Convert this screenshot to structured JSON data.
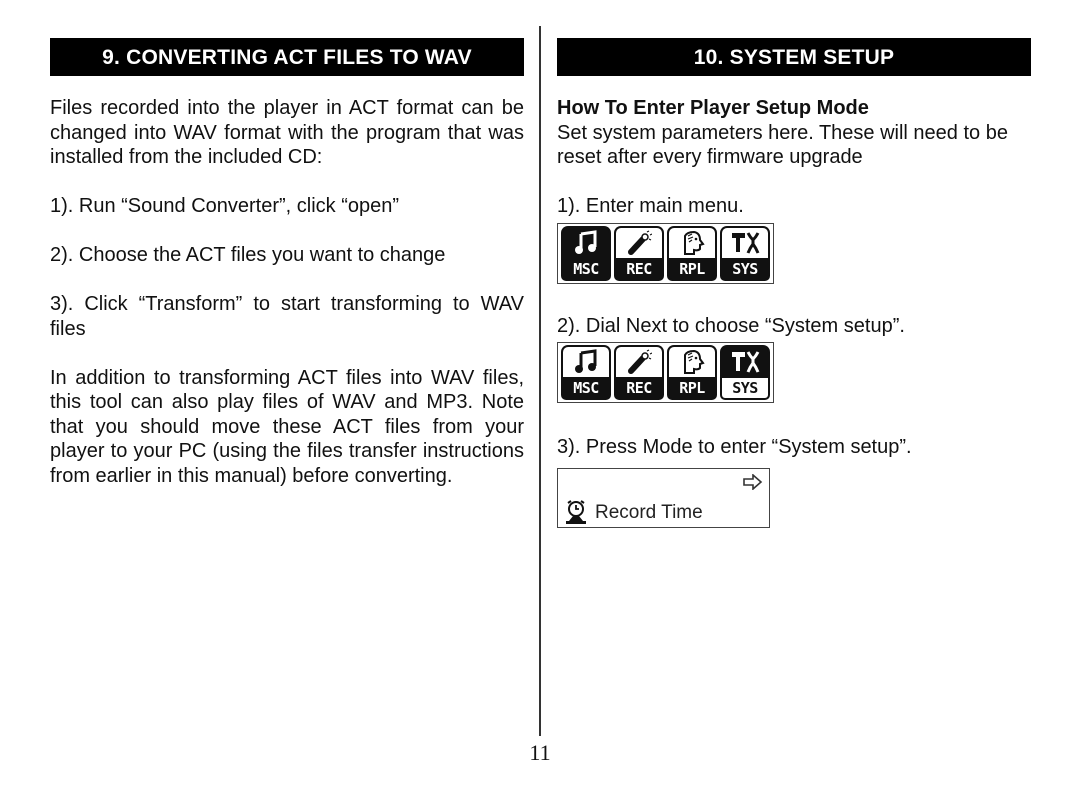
{
  "page_number": "11",
  "left": {
    "heading": "9. CONVERTING ACT FILES TO WAV",
    "intro": "Files recorded into the player in ACT format can be changed into WAV format with the program that was installed from the included CD:",
    "steps": [
      "1). Run “Sound Converter”, click “open”",
      "2). Choose the ACT files you want to change",
      "3). Click “Transform” to start transforming to WAV files"
    ],
    "note": "In addition to transforming ACT files into WAV files, this tool can also play files of WAV and MP3.  Note that you should move these ACT files from your player to your PC (using the files transfer instructions from earlier in this manual) before converting."
  },
  "right": {
    "heading": "10. SYSTEM SETUP",
    "subheading": "How To Enter Player Setup Mode",
    "intro": "Set system parameters here. These will need to be reset after every firmware upgrade",
    "steps": [
      "1). Enter main menu.",
      "2). Dial Next to choose “System setup”.",
      "3). Press Mode to enter “System setup”."
    ],
    "menu_items": [
      {
        "label": "MSC",
        "icon": "music-note-icon"
      },
      {
        "label": "REC",
        "icon": "microphone-icon"
      },
      {
        "label": "RPL",
        "icon": "replay-head-icon"
      },
      {
        "label": "SYS",
        "icon": "tools-icon"
      }
    ],
    "menu_1_selected": "MSC",
    "menu_2_selected": "SYS",
    "screen": {
      "label": "Record Time",
      "icon": "alarm-clock-icon",
      "nav_icon": "right-arrow-icon"
    }
  }
}
